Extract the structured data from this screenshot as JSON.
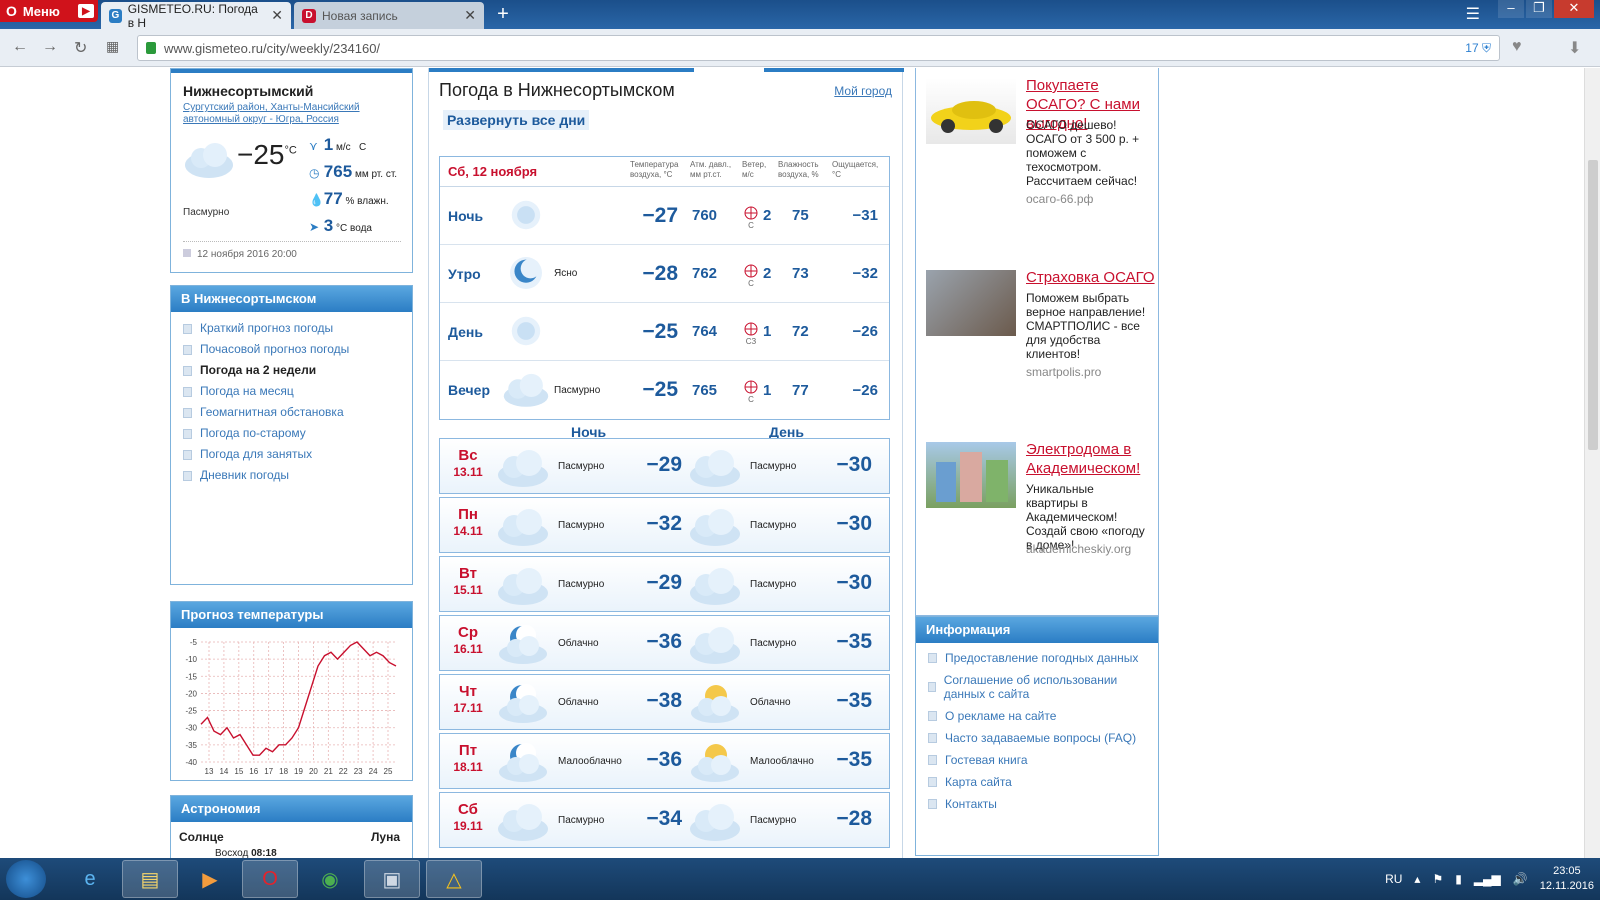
{
  "browser": {
    "menu_label": "Меню",
    "tabs": [
      {
        "title": "GISMETEO.RU: Погода в Н"
      },
      {
        "title": "Новая запись"
      }
    ],
    "url": "www.gismeteo.ru/city/weekly/234160/",
    "badge_count": "17"
  },
  "current": {
    "city": "Нижнесортымский",
    "region": "Сургутский район, Ханты-Мансийский автономный округ - Югра, Россия",
    "temp": "−25",
    "temp_unit": "°C",
    "wind": "1",
    "wind_unit": "м/с",
    "wind_dir": "С",
    "pressure": "765",
    "pressure_unit": "мм рт. ст.",
    "humidity": "77",
    "humidity_unit": "% влажн.",
    "water": "3",
    "water_unit": "°C вода",
    "condition": "Пасмурно",
    "updated": "12 ноября 2016 20:00"
  },
  "nav": {
    "title": "В Нижнесортымском",
    "items": [
      "Краткий прогноз погоды",
      "Почасовой прогноз погоды",
      "Погода на 2 недели",
      "Погода на месяц",
      "Геомагнитная обстановка",
      "Погода по-старому",
      "Погода для занятых",
      "Дневник погоды"
    ],
    "selected_index": 2
  },
  "temp_chart": {
    "title": "Прогноз температуры"
  },
  "chart_data": {
    "type": "line",
    "title": "Прогноз температуры",
    "x_ticks": [
      "13",
      "14",
      "15",
      "16",
      "17",
      "18",
      "19",
      "20",
      "21",
      "22",
      "23",
      "24",
      "25"
    ],
    "y_ticks": [
      -5,
      -10,
      -15,
      -20,
      -25,
      -30,
      -35,
      -40
    ],
    "ylim": [
      -40,
      -5
    ],
    "grid": true,
    "series": [
      {
        "values": [
          -29,
          -27,
          -31,
          -32,
          -30,
          -33,
          -32,
          -35,
          -38,
          -38,
          -36,
          -37,
          -35,
          -35,
          -33,
          -30,
          -24,
          -18,
          -12,
          -9,
          -8,
          -10,
          -8,
          -6,
          -5,
          -7,
          -9,
          -8,
          -9,
          -11,
          -12
        ]
      }
    ]
  },
  "astronomy": {
    "title": "Астрономия",
    "sun": "Солнце",
    "moon": "Луна",
    "sunrise_label": "Восход",
    "sunrise": "08:18"
  },
  "main": {
    "title": "Погода в Нижнесортымском",
    "my_city": "Мой город",
    "expand": "Развернуть все дни",
    "day_label": "Сб, 12 ноября",
    "col_headers": {
      "temp": "Температура воздуха, °C",
      "pressure": "Атм. давл., мм рт.ст.",
      "wind": "Ветер, м/с",
      "humidity": "Влажность воздуха, %",
      "feels": "Ощущается, °C"
    },
    "periods": [
      {
        "label": "Ночь",
        "cond": "",
        "temp": "−27",
        "pressure": "760",
        "wind": "2",
        "wind_dir": "С",
        "humidity": "75",
        "feels": "−31",
        "icon": "night-clear-icon"
      },
      {
        "label": "Утро",
        "cond": "Ясно",
        "temp": "−28",
        "pressure": "762",
        "wind": "2",
        "wind_dir": "С",
        "humidity": "73",
        "feels": "−32",
        "icon": "moon-icon"
      },
      {
        "label": "День",
        "cond": "",
        "temp": "−25",
        "pressure": "764",
        "wind": "1",
        "wind_dir": "СЗ",
        "humidity": "72",
        "feels": "−26",
        "icon": "day-clear-icon"
      },
      {
        "label": "Вечер",
        "cond": "Пасмурно",
        "temp": "−25",
        "pressure": "765",
        "wind": "1",
        "wind_dir": "С",
        "humidity": "77",
        "feels": "−26",
        "icon": "cloud-icon"
      }
    ],
    "night_label": "Ночь",
    "day_label2": "День",
    "days": [
      {
        "dow": "Вс",
        "date": "13.11",
        "n_cond": "Пасмурно",
        "n_temp": "−29",
        "d_cond": "Пасмурно",
        "d_temp": "−30",
        "n_icon": "cloud-icon",
        "d_icon": "cloud-icon"
      },
      {
        "dow": "Пн",
        "date": "14.11",
        "n_cond": "Пасмурно",
        "n_temp": "−32",
        "d_cond": "Пасмурно",
        "d_temp": "−30",
        "n_icon": "cloud-icon",
        "d_icon": "cloud-icon"
      },
      {
        "dow": "Вт",
        "date": "15.11",
        "n_cond": "Пасмурно",
        "n_temp": "−29",
        "d_cond": "Пасмурно",
        "d_temp": "−30",
        "n_icon": "cloud-icon",
        "d_icon": "cloud-icon"
      },
      {
        "dow": "Ср",
        "date": "16.11",
        "n_cond": "Облачно",
        "n_temp": "−36",
        "d_cond": "Пасмурно",
        "d_temp": "−35",
        "n_icon": "moon-cloud-icon",
        "d_icon": "cloud-icon"
      },
      {
        "dow": "Чт",
        "date": "17.11",
        "n_cond": "Облачно",
        "n_temp": "−38",
        "d_cond": "Облачно",
        "d_temp": "−35",
        "n_icon": "moon-cloud-icon",
        "d_icon": "sun-cloud-icon"
      },
      {
        "dow": "Пт",
        "date": "18.11",
        "n_cond": "Малооблачно",
        "n_temp": "−36",
        "d_cond": "Малооблачно",
        "d_temp": "−35",
        "n_icon": "moon-cloud-icon",
        "d_icon": "sun-cloud-icon"
      },
      {
        "dow": "Сб",
        "date": "19.11",
        "n_cond": "Пасмурно",
        "n_temp": "−34",
        "d_cond": "Пасмурно",
        "d_temp": "−28",
        "n_icon": "cloud-icon",
        "d_icon": "cloud-icon"
      }
    ]
  },
  "ads": [
    {
      "title": "Покупаете ОСАГО? С нами выгодно!",
      "text": "ОСАГО дешево! ОСАГО от 3 500 р. + поможем с техосмотром. Рассчитаем сейчас!",
      "src": "осаго-66.рф",
      "img": "yellow-car-image"
    },
    {
      "title": "Страховка ОСАГО",
      "text": "Поможем выбрать верное направление! СМАРТПОЛИС - все для удобства клиентов!",
      "src": "smartpolis.pro",
      "img": "money-keys-image"
    },
    {
      "title": "Электродома в Академическом!",
      "text": "Уникальные квартиры в Академическом! Создай свою «погоду в доме»!",
      "src": "akademicheskiy.org",
      "img": "buildings-image"
    }
  ],
  "info": {
    "title": "Информация",
    "items": [
      "Предоставление погодных данных",
      "Соглашение об использовании данных с сайта",
      "О рекламе на сайте",
      "Часто задаваемые вопросы (FAQ)",
      "Гостевая книга",
      "Карта сайта",
      "Контакты"
    ]
  },
  "taskbar": {
    "lang": "RU",
    "time": "23:05",
    "date": "12.11.2016"
  },
  "colors": {
    "accent": "#2b7dc4",
    "date_red": "#c8102e",
    "link": "#3a78b8"
  }
}
